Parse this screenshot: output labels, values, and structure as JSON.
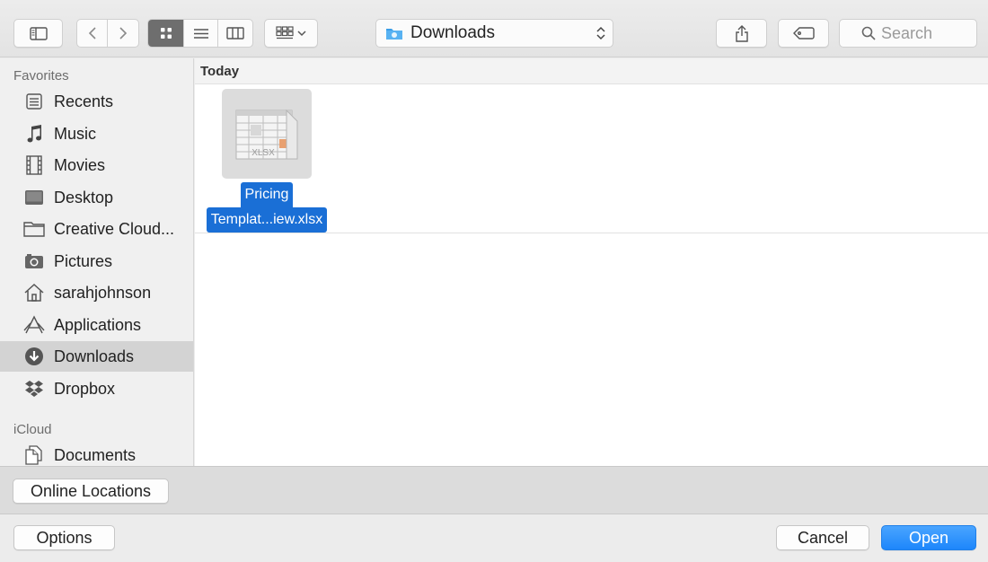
{
  "toolbar": {
    "view_modes": [
      "icon",
      "list",
      "column"
    ],
    "active_view": "icon",
    "location": "Downloads",
    "search_placeholder": "Search"
  },
  "sidebar": {
    "favorites_heading": "Favorites",
    "favorites": [
      {
        "label": "Recents",
        "icon": "recents-icon"
      },
      {
        "label": "Music",
        "icon": "music-icon"
      },
      {
        "label": "Movies",
        "icon": "movies-icon"
      },
      {
        "label": "Desktop",
        "icon": "desktop-icon"
      },
      {
        "label": "Creative Cloud...",
        "icon": "folder-icon"
      },
      {
        "label": "Pictures",
        "icon": "camera-icon"
      },
      {
        "label": "sarahjohnson",
        "icon": "home-icon"
      },
      {
        "label": "Applications",
        "icon": "applications-icon"
      },
      {
        "label": "Downloads",
        "icon": "downloads-icon",
        "selected": true
      },
      {
        "label": "Dropbox",
        "icon": "dropbox-icon"
      }
    ],
    "icloud_heading": "iCloud",
    "icloud": [
      {
        "label": "Documents",
        "icon": "documents-icon"
      }
    ]
  },
  "content": {
    "section_title": "Today",
    "file": {
      "name_line1": "Pricing",
      "name_line2": "Templat...iew.xlsx",
      "type_label": "XLSX",
      "selected": true
    }
  },
  "bottom": {
    "online_locations": "Online Locations",
    "options": "Options",
    "cancel": "Cancel",
    "open": "Open"
  },
  "colors": {
    "selection_blue": "#1a6fd6",
    "primary_button": "#1d86fb",
    "sidebar_selected": "#d3d3d3"
  }
}
